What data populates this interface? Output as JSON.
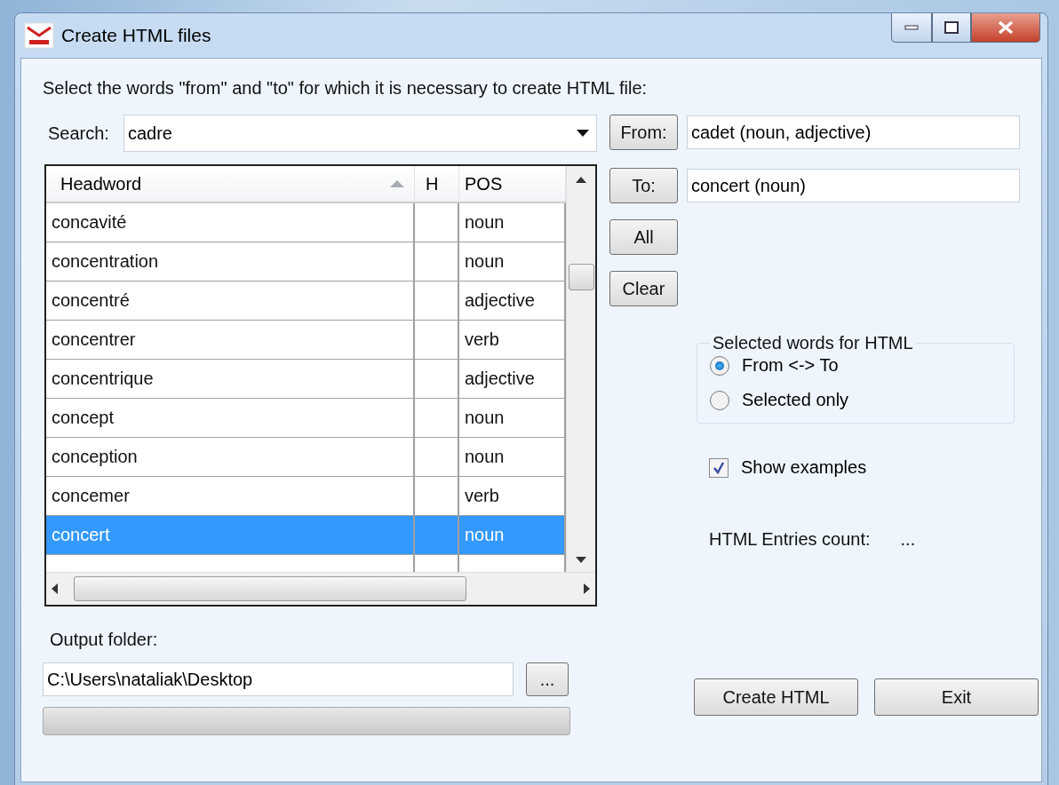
{
  "window": {
    "title": "Create HTML files"
  },
  "instruction": "Select the words \"from\" and \"to\" for which it is necessary to create HTML file:",
  "search": {
    "label": "Search:",
    "value": "cadre"
  },
  "table": {
    "columns": [
      {
        "label": "Headword",
        "sorted": true
      },
      {
        "label": "H",
        "sorted": false
      },
      {
        "label": "POS",
        "sorted": false
      }
    ],
    "rows": [
      {
        "headword": "concavité",
        "pos": "noun",
        "selected": false
      },
      {
        "headword": "concentration",
        "pos": "noun",
        "selected": false
      },
      {
        "headword": "concentré",
        "pos": "adjective",
        "selected": false
      },
      {
        "headword": "concentrer",
        "pos": "verb",
        "selected": false
      },
      {
        "headword": "concentrique",
        "pos": "adjective",
        "selected": false
      },
      {
        "headword": "concept",
        "pos": "noun",
        "selected": false
      },
      {
        "headword": "conception",
        "pos": "noun",
        "selected": false
      },
      {
        "headword": "concemer",
        "pos": "verb",
        "selected": false
      },
      {
        "headword": "concert",
        "pos": "noun",
        "selected": true
      }
    ]
  },
  "range": [
    {
      "button": "From:",
      "value": "cadet (noun, adjective)"
    },
    {
      "button": "To:",
      "value": "concert (noun)"
    }
  ],
  "actions": [
    "All",
    "Clear"
  ],
  "group": {
    "title": "Selected words for HTML",
    "options": [
      {
        "label": "From <-> To",
        "selected": true
      },
      {
        "label": "Selected only",
        "selected": false
      }
    ]
  },
  "show_examples": {
    "label": "Show examples",
    "checked": true
  },
  "count": {
    "label": "HTML Entries count:",
    "value": "..."
  },
  "output": {
    "label": "Output folder:",
    "value": "C:\\Users\\nataliak\\Desktop",
    "browse": "...",
    "progress": {
      "level": 0
    }
  },
  "buttons": [
    "Create HTML",
    "Exit"
  ]
}
